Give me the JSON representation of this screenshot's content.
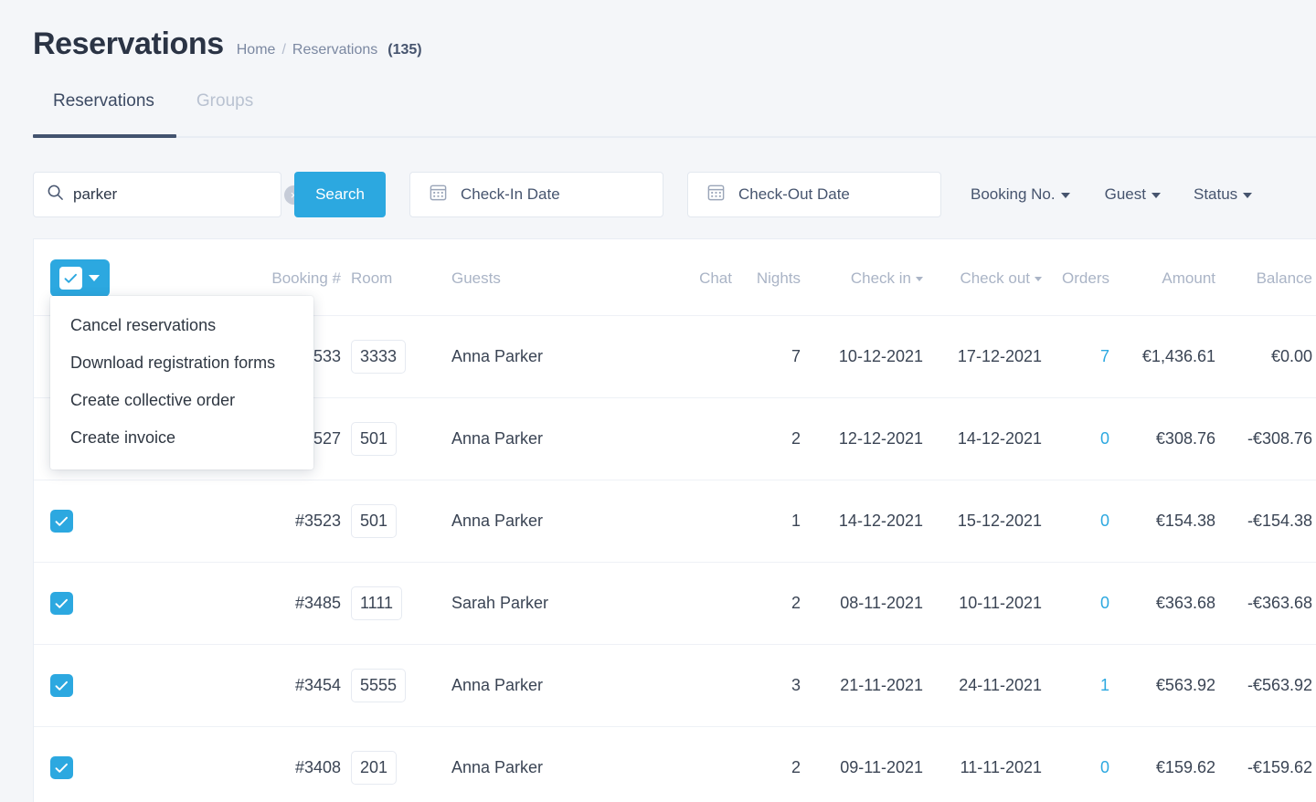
{
  "header": {
    "title": "Reservations",
    "breadcrumb": {
      "home": "Home",
      "separator": "/",
      "current": "Reservations",
      "count": "(135)"
    }
  },
  "tabs": [
    {
      "label": "Reservations",
      "active": true
    },
    {
      "label": "Groups",
      "active": false
    }
  ],
  "filters": {
    "search": {
      "value": "parker",
      "placeholder": "Search",
      "clear_label": "×",
      "icon": "search-icon"
    },
    "search_button": "Search",
    "checkin_date": {
      "label": "Check-In Date",
      "icon": "calendar-icon"
    },
    "checkout_date": {
      "label": "Check-Out Date",
      "icon": "calendar-icon"
    },
    "booking_no": "Booking No.",
    "guest": "Guest",
    "status": "Status"
  },
  "action_menu": {
    "items": [
      "Cancel reservations",
      "Download registration forms",
      "Create collective order",
      "Create invoice"
    ]
  },
  "table": {
    "select_all": {
      "checked": true,
      "icon": "checkbox-checked-icon",
      "caret": "chevron-down-icon"
    },
    "columns": [
      {
        "key": "check",
        "label": ""
      },
      {
        "key": "book",
        "label": "Booking #"
      },
      {
        "key": "room",
        "label": "Room"
      },
      {
        "key": "guest",
        "label": "Guests"
      },
      {
        "key": "chat",
        "label": "Chat"
      },
      {
        "key": "nights",
        "label": "Nights"
      },
      {
        "key": "in",
        "label": "Check in",
        "sortable": true
      },
      {
        "key": "out",
        "label": "Check out",
        "sortable": true
      },
      {
        "key": "orders",
        "label": "Orders"
      },
      {
        "key": "amount",
        "label": "Amount"
      },
      {
        "key": "bal",
        "label": "Balance"
      }
    ],
    "rows": [
      {
        "checked": true,
        "booking": "#3533",
        "room": "3333",
        "guest": "Anna Parker",
        "chat": "",
        "nights": "7",
        "checkin": "10-12-2021",
        "checkout": "17-12-2021",
        "orders": "7",
        "amount": "€1,436.61",
        "balance": "€0.00"
      },
      {
        "checked": true,
        "booking": "#3527",
        "room": "501",
        "guest": "Anna Parker",
        "chat": "",
        "nights": "2",
        "checkin": "12-12-2021",
        "checkout": "14-12-2021",
        "orders": "0",
        "amount": "€308.76",
        "balance": "-€308.76"
      },
      {
        "checked": true,
        "booking": "#3523",
        "room": "501",
        "guest": "Anna Parker",
        "chat": "",
        "nights": "1",
        "checkin": "14-12-2021",
        "checkout": "15-12-2021",
        "orders": "0",
        "amount": "€154.38",
        "balance": "-€154.38"
      },
      {
        "checked": true,
        "booking": "#3485",
        "room": "1111",
        "guest": "Sarah Parker",
        "chat": "",
        "nights": "2",
        "checkin": "08-11-2021",
        "checkout": "10-11-2021",
        "orders": "0",
        "amount": "€363.68",
        "balance": "-€363.68"
      },
      {
        "checked": true,
        "booking": "#3454",
        "room": "5555",
        "guest": "Anna Parker",
        "chat": "",
        "nights": "3",
        "checkin": "21-11-2021",
        "checkout": "24-11-2021",
        "orders": "1",
        "amount": "€563.92",
        "balance": "-€563.92"
      },
      {
        "checked": true,
        "booking": "#3408",
        "room": "201",
        "guest": "Anna Parker",
        "chat": "",
        "nights": "2",
        "checkin": "09-11-2021",
        "checkout": "11-11-2021",
        "orders": "0",
        "amount": "€159.62",
        "balance": "-€159.62"
      }
    ]
  },
  "colors": {
    "accent": "#2ca8e0",
    "page_bg": "#f4f6f9",
    "tab_active_underline": "#43536f",
    "muted_text": "#aab4c6"
  }
}
